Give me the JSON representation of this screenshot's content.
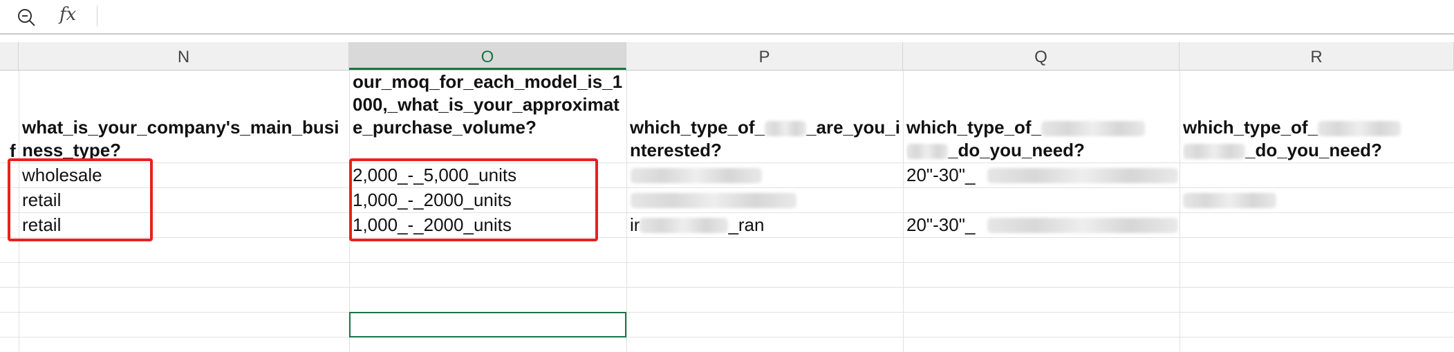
{
  "formula_bar": {
    "zoom_icon": "zoom-out-icon",
    "fx_label": "fx",
    "value": ""
  },
  "columns": [
    {
      "letter": "N"
    },
    {
      "letter": "O"
    },
    {
      "letter": "P"
    },
    {
      "letter": "Q"
    },
    {
      "letter": "R"
    }
  ],
  "header": {
    "n": "what_is_your_company's_main_business_type?",
    "n_prefix": "f",
    "o": "our_moq_for_each_model_is_1000,_what_is_your_approximate_purchase_volume?",
    "p_a": "which_type_of_",
    "p_b": "_are_",
    "p_c": "you_interested?",
    "q_a": "which_type_of_",
    "q_b": "_do_you_need?",
    "r_a": "which_type_of_",
    "r_b": "_do_you_need?"
  },
  "rows": [
    {
      "n": "wholesale",
      "o": "2,000_-_5,000_units",
      "p": "",
      "q": "20\"-30\"_"
    },
    {
      "n": "retail",
      "o": "1,000_-_2000_units",
      "p": "",
      "q": ""
    },
    {
      "n": "retail",
      "o": "1,000_-_2000_units",
      "p_a": "ir",
      "p_b": "_ran",
      "q": "20\"-30\"_"
    }
  ],
  "highlight_color": "#e8201e",
  "selection_color": "#1a7346"
}
